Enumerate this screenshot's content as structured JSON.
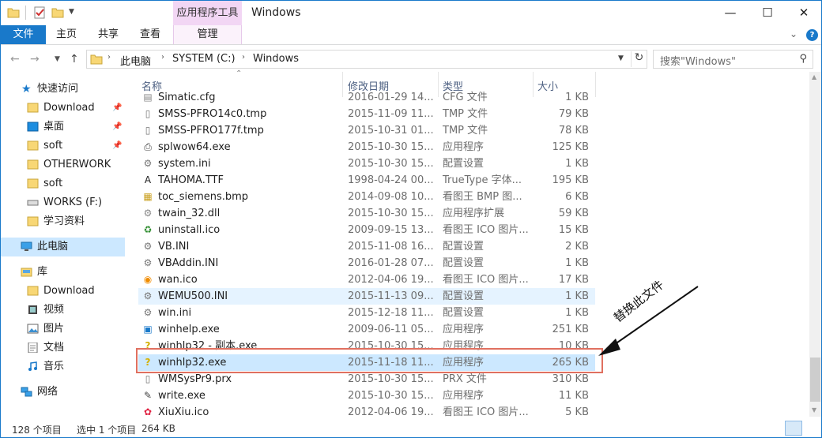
{
  "window": {
    "title": "Windows",
    "context_tab": "应用程序工具"
  },
  "ribbon": {
    "tabs": {
      "file": "文件",
      "home": "主页",
      "share": "共享",
      "view": "查看",
      "manage": "管理"
    }
  },
  "address": {
    "crumbs": [
      "此电脑",
      "SYSTEM (C:)",
      "Windows"
    ],
    "search_placeholder": "搜索\"Windows\""
  },
  "nav": {
    "quick_access": "快速访问",
    "quick_items": [
      "Download",
      "桌面",
      "soft",
      "OTHERWORK",
      "soft",
      "WORKS (F:)",
      "学习资料"
    ],
    "this_pc": "此电脑",
    "library": "库",
    "library_items": [
      "Download",
      "视频",
      "图片",
      "文档",
      "音乐"
    ],
    "network": "网络"
  },
  "columns": {
    "name": "名称",
    "date": "修改日期",
    "type": "类型",
    "size": "大小"
  },
  "files": [
    {
      "name": "Simatic.cfg",
      "date": "2016-01-29 14...",
      "type": "CFG 文件",
      "size": "1 KB",
      "icon": "cfg-icon"
    },
    {
      "name": "SMSS-PFRO14c0.tmp",
      "date": "2015-11-09 11...",
      "type": "TMP 文件",
      "size": "79 KB",
      "icon": "file-icon"
    },
    {
      "name": "SMSS-PFRO177f.tmp",
      "date": "2015-10-31 01...",
      "type": "TMP 文件",
      "size": "78 KB",
      "icon": "file-icon"
    },
    {
      "name": "splwow64.exe",
      "date": "2015-10-30 15...",
      "type": "应用程序",
      "size": "125 KB",
      "icon": "printer-icon"
    },
    {
      "name": "system.ini",
      "date": "2015-10-30 15...",
      "type": "配置设置",
      "size": "1 KB",
      "icon": "ini-icon"
    },
    {
      "name": "TAHOMA.TTF",
      "date": "1998-04-24 00...",
      "type": "TrueType 字体...",
      "size": "195 KB",
      "icon": "font-icon"
    },
    {
      "name": "toc_siemens.bmp",
      "date": "2014-09-08 10...",
      "type": "看图王 BMP 图...",
      "size": "6 KB",
      "icon": "bmp-icon"
    },
    {
      "name": "twain_32.dll",
      "date": "2015-10-30 15...",
      "type": "应用程序扩展",
      "size": "59 KB",
      "icon": "dll-icon"
    },
    {
      "name": "uninstall.ico",
      "date": "2009-09-15 13...",
      "type": "看图王 ICO 图片...",
      "size": "15 KB",
      "icon": "recycle-icon"
    },
    {
      "name": "VB.INI",
      "date": "2015-11-08 16...",
      "type": "配置设置",
      "size": "2 KB",
      "icon": "ini-icon"
    },
    {
      "name": "VBAddin.INI",
      "date": "2016-01-28 07...",
      "type": "配置设置",
      "size": "1 KB",
      "icon": "ini-icon"
    },
    {
      "name": "wan.ico",
      "date": "2012-04-06 19...",
      "type": "看图王 ICO 图片...",
      "size": "17 KB",
      "icon": "globe-icon"
    },
    {
      "name": "WEMU500.INI",
      "date": "2015-11-13 09...",
      "type": "配置设置",
      "size": "1 KB",
      "icon": "ini-icon"
    },
    {
      "name": "win.ini",
      "date": "2015-12-18 11...",
      "type": "配置设置",
      "size": "1 KB",
      "icon": "ini-icon"
    },
    {
      "name": "winhelp.exe",
      "date": "2009-06-11 05...",
      "type": "应用程序",
      "size": "251 KB",
      "icon": "window-icon"
    },
    {
      "name": "winhlp32 - 副本.exe",
      "date": "2015-10-30 15...",
      "type": "应用程序",
      "size": "10 KB",
      "icon": "help-question-icon"
    },
    {
      "name": "winhlp32.exe",
      "date": "2015-11-18 11...",
      "type": "应用程序",
      "size": "265 KB",
      "icon": "help-question-icon"
    },
    {
      "name": "WMSysPr9.prx",
      "date": "2015-10-30 15...",
      "type": "PRX 文件",
      "size": "310 KB",
      "icon": "file-icon"
    },
    {
      "name": "write.exe",
      "date": "2015-10-30 15...",
      "type": "应用程序",
      "size": "11 KB",
      "icon": "write-icon"
    },
    {
      "name": "XiuXiu.ico",
      "date": "2012-04-06 19...",
      "type": "看图王 ICO 图片...",
      "size": "5 KB",
      "icon": "xiuxiu-icon"
    }
  ],
  "status": {
    "count": "128 个项目",
    "selected": "选中 1 个项目",
    "selected_size": "264 KB"
  },
  "annotation": {
    "text": "替换此文件",
    "color": "#e07060"
  }
}
